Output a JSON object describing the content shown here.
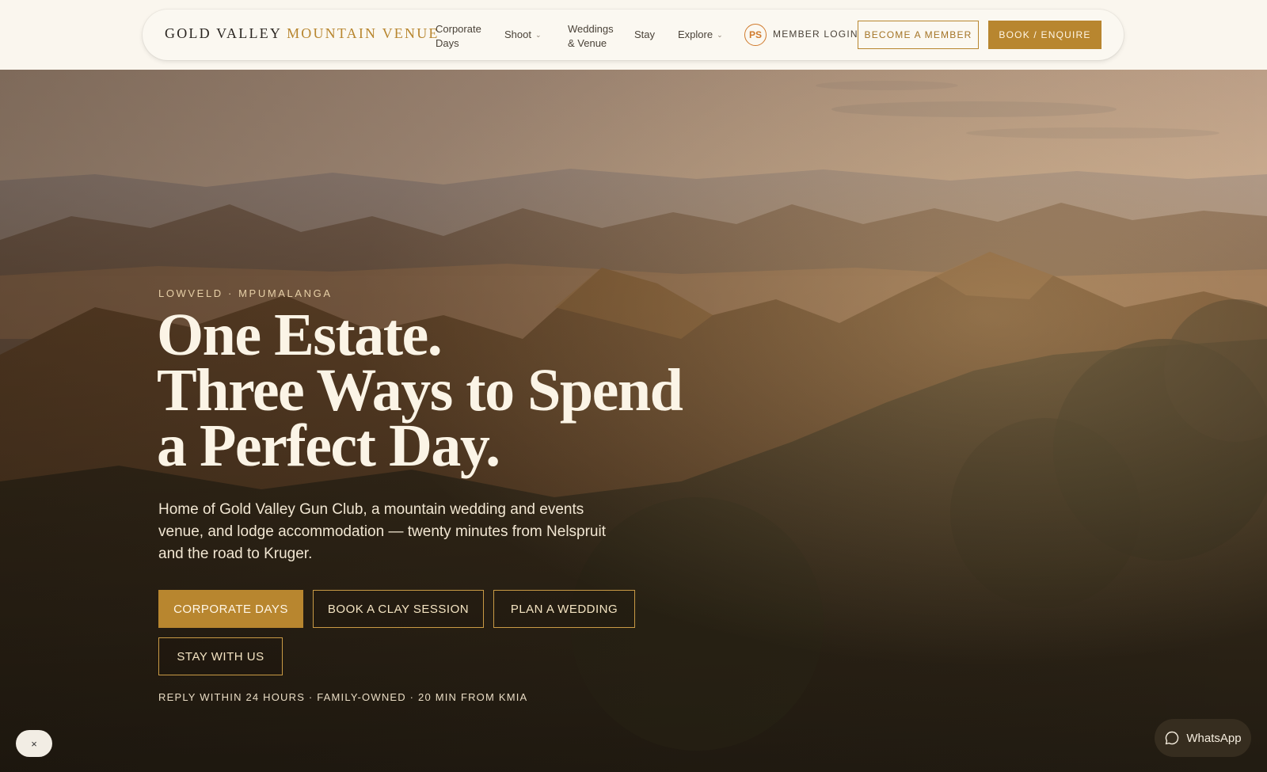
{
  "header": {
    "logo_primary": "GOLD VALLEY",
    "logo_accent": "MOUNTAIN VENUE",
    "nav": [
      {
        "line1": "Corporate",
        "line2": "Days"
      },
      {
        "label": "Shoot"
      },
      {
        "line1": "Weddings",
        "line2": "& Venue"
      },
      {
        "label": "Stay"
      },
      {
        "label": "Explore"
      }
    ],
    "avatar_initials": "PS",
    "member_login": "MEMBER LOGIN",
    "become_member": "BECOME A MEMBER",
    "book_enquire": "BOOK / ENQUIRE"
  },
  "hero": {
    "eyebrow": "LOWVELD · MPUMALANGA",
    "headline": [
      "One Estate.",
      "Three Ways to Spend",
      "a Perfect Day."
    ],
    "lede": "Home of Gold Valley Gun Club, a mountain wedding and events venue, and lodge accommodation — twenty minutes from Nelspruit and the road to Kruger.",
    "ctas": {
      "corporate": "CORPORATE DAYS",
      "clay": "BOOK A CLAY SESSION",
      "wedding": "PLAN A WEDDING",
      "stay": "STAY WITH US"
    },
    "trust_line": "REPLY WITHIN 24 HOURS · FAMILY-OWNED · 20 MIN FROM KMIA"
  },
  "widgets": {
    "close_glyph": "×",
    "whatsapp_label": "WhatsApp"
  },
  "colors": {
    "accent": "#b8862f",
    "header_bg": "#faf6ee",
    "headline": "#fbf4e6"
  },
  "icons": [
    "chevron-down-icon",
    "close-icon",
    "whatsapp-icon"
  ]
}
